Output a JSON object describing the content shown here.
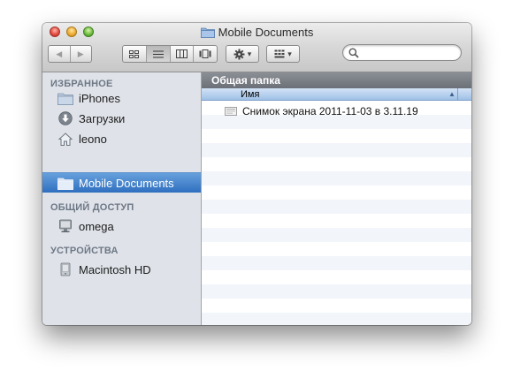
{
  "window": {
    "title": "Mobile Documents",
    "title_icon": "folder-icon"
  },
  "toolbar": {
    "back_icon": "◀",
    "forward_icon": "▶",
    "views": [
      "icon-view-icon",
      "list-view-icon",
      "column-view-icon",
      "coverflow-view-icon"
    ],
    "active_view": "list-view-icon",
    "action_icon": "gear-icon",
    "arrange_icon": "arrange-icon",
    "dropdown_arrow": "▾"
  },
  "search": {
    "value": "",
    "placeholder": ""
  },
  "sidebar": {
    "favorites_header": "ИЗБРАННОЕ",
    "favorites": [
      {
        "label": "iPhones",
        "icon": "folder-icon"
      },
      {
        "label": "Загрузки",
        "icon": "downloads-icon"
      },
      {
        "label": "leono",
        "icon": "home-icon"
      },
      {
        "label": "Mobile Documents",
        "icon": "folder-icon",
        "selected": true
      }
    ],
    "shared_header": "ОБЩИЙ ДОСТУП",
    "shared": [
      {
        "label": "omega",
        "icon": "computer-icon"
      }
    ],
    "devices_header": "УСТРОЙСТВА",
    "devices": [
      {
        "label": "Macintosh HD",
        "icon": "hard-drive-icon"
      }
    ]
  },
  "path_bar": {
    "label": "Общая папка"
  },
  "list": {
    "column_header": "Имя",
    "sort_icon": "▲",
    "files": [
      {
        "name": "Снимок экрана 2011-11-03 в 3.11.19",
        "icon": "screenshot-file-icon"
      }
    ]
  },
  "colors": {
    "selection": "#3d7dcc",
    "sidebar_bg": "#dfe3e9",
    "header_blue": "#b9d1ee",
    "path_bar": "#7a7e85"
  }
}
